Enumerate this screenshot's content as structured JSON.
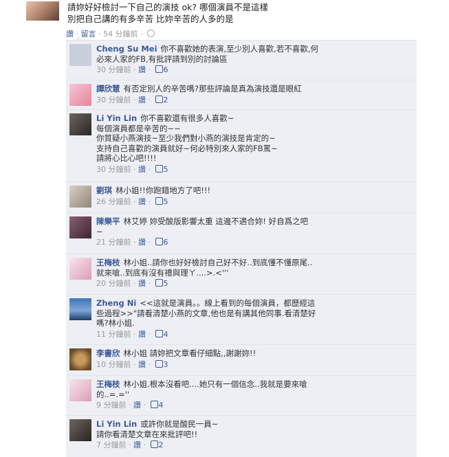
{
  "post": {
    "text_line1": "請妳好好檢討一下自己的演技 ok? 哪個演員不是這樣",
    "text_line2": "別把自己講的有多辛苦 比妳辛苦的人多的是",
    "like_label": "讚",
    "sep": "·",
    "comment_label": "留言",
    "time": "54 分鐘前"
  },
  "comments": [
    {
      "author": "Cheng Su Mei",
      "text": "你不喜歡她的表演,至少別人喜歡,若不喜歡,何\n必來人家的FB,有批評請到別的討論區",
      "time": "30 分鐘前",
      "like_label": "讚",
      "likes": "6"
    },
    {
      "author": "譚欣慧",
      "text": "有否定別人的辛苦嗎?那些評論是真為演技還是眼紅",
      "time": "30 分鐘前",
      "like_label": "讚",
      "likes": "2"
    },
    {
      "author": "Li Yin Lin",
      "text": "你不喜歡還有很多人喜歡~\n每個演員都是辛苦的~~\n你質疑小燕演技~至少我們對小燕的演技是肯定的~\n支持自己喜歡的演員就好~何必特別來人家的FB罵~\n請將心比心吧!!!!",
      "time": "30 分鐘前",
      "like_label": "讚",
      "likes": "5"
    },
    {
      "author": "劉琪",
      "text": "林小姐!!你跑錯地方了吧!!!",
      "time": "26 分鐘前",
      "like_label": "讚",
      "likes": "5"
    },
    {
      "author": "陳樂平",
      "text": "林艾婷 妳受酸版影響太重 這邊不適合妳! 好自爲之吧\n~",
      "time": "21 分鐘前",
      "like_label": "讚",
      "likes": "6"
    },
    {
      "author": "王梅枝",
      "text": "林小姐..請你也好好檢討自己好不好..到底懂不懂原尾..\n就來嗆..到底有沒有禮與理ㄚ....>.<'''",
      "time": "20 分鐘前",
      "like_label": "讚",
      "likes": "5"
    },
    {
      "author": "Zheng Ni",
      "text": "<<這就是演員。。線上看到的每個演員，都歷經這\n些過程>>\"請看清楚小燕的文章,他也是有講其他同事.看清楚好\n嗎?林小姐.",
      "time": "11 分鐘前",
      "like_label": "讚",
      "likes": "4"
    },
    {
      "author": "李書欣",
      "text": "林小姐 請妳把文章看仔細點,,謝謝妳!!",
      "time": "10 分鐘前",
      "like_label": "讚",
      "likes": "3"
    },
    {
      "author": "王梅枝",
      "text": "林小姐.根本沒看吧....她只有一個信念..我就是要來嗆\n的..=.=''",
      "time": "9 分鐘前",
      "like_label": "讚",
      "likes": "4"
    },
    {
      "author": "Li Yin Lin",
      "text": "或許你就是酸民一員~\n請你看清楚文章在來批評吧!!",
      "time": "7 分鐘前",
      "like_label": "讚",
      "likes": "2"
    }
  ]
}
